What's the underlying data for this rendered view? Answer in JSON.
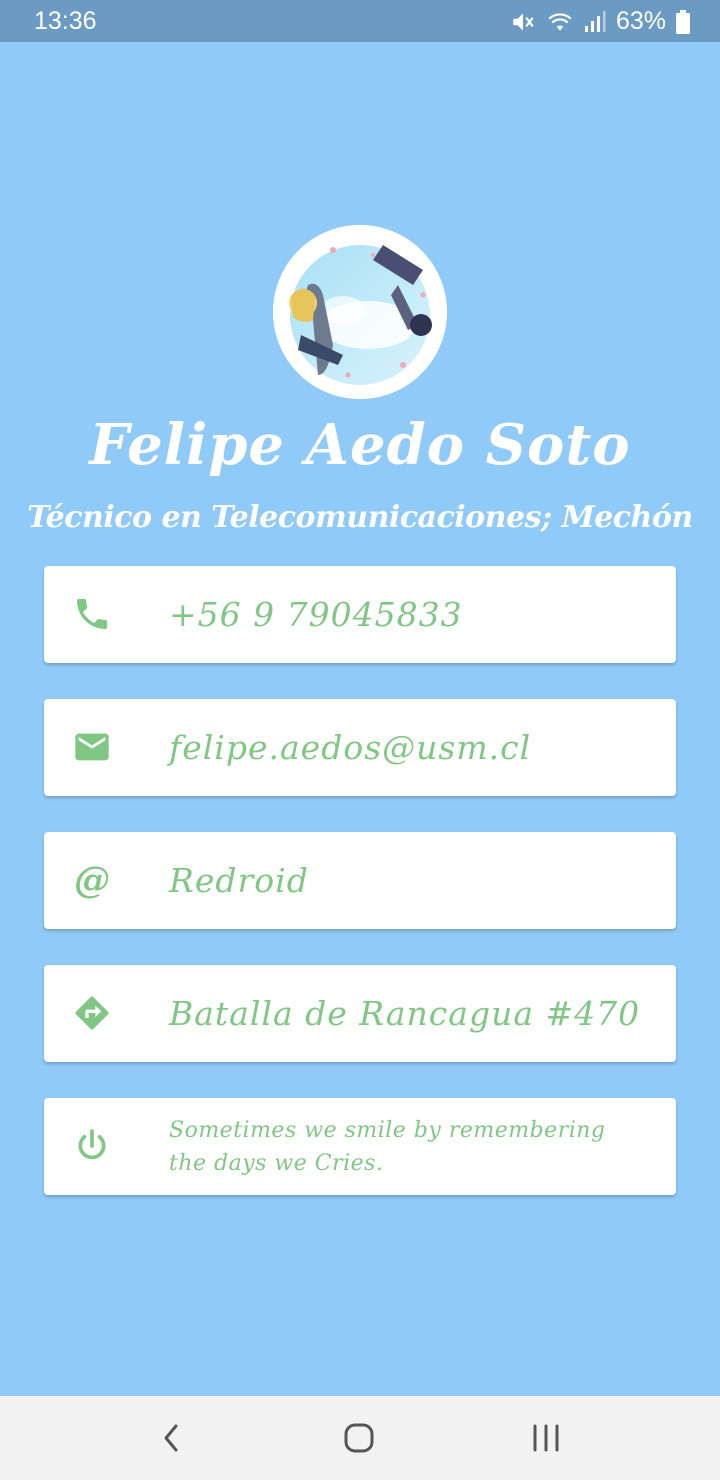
{
  "status_bar": {
    "time": "13:36",
    "battery_percent": "63%",
    "icons": [
      "mute-icon",
      "wifi-icon",
      "signal-icon",
      "battery-icon"
    ]
  },
  "profile": {
    "name": "Felipe Aedo Soto",
    "title": "Técnico en Telecomunicaciones; Mechón"
  },
  "contacts": [
    {
      "icon": "phone-icon",
      "text": "+56 9 79045833"
    },
    {
      "icon": "mail-icon",
      "text": "felipe.aedos@usm.cl"
    },
    {
      "icon": "at-icon",
      "symbol": "@",
      "text": "Redroid"
    },
    {
      "icon": "directions-icon",
      "text": "Batalla de Rancagua #470"
    },
    {
      "icon": "power-icon",
      "text": "Sometimes we smile by remembering the days we Cries."
    }
  ],
  "nav_bar": {
    "buttons": [
      "back-icon",
      "home-icon",
      "recents-icon"
    ]
  },
  "colors": {
    "background": "#90CAF9",
    "status_bar": "#6B9BC3",
    "accent": "#81C784",
    "card": "#FFFFFF",
    "nav_bar": "#F2F2F2"
  }
}
